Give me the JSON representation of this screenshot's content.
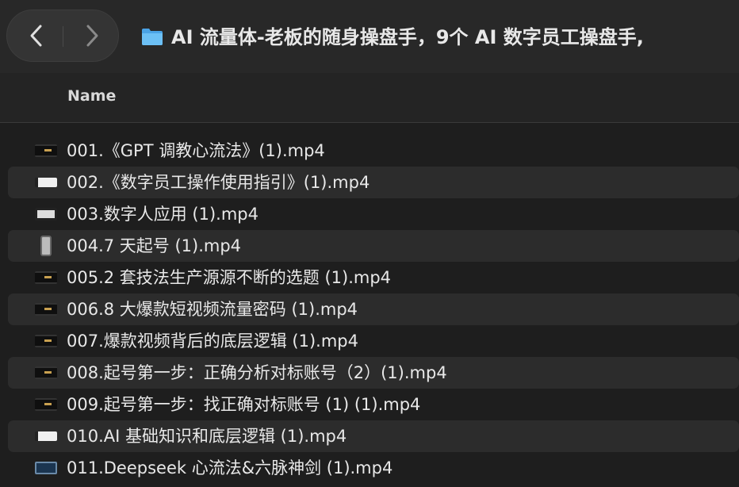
{
  "window": {
    "title": "AI 流量体-老板的随身操盘手，9个 AI 数字员工操盘手,"
  },
  "nav": {
    "back_icon": "chevron-left-icon",
    "forward_icon": "chevron-right-icon"
  },
  "header": {
    "name_label": "Name"
  },
  "files": [
    {
      "name": "001.《GPT 调教心流法》(1).mp4",
      "thumb": "dark-strip"
    },
    {
      "name": "002.《数字员工操作使用指引》(1).mp4",
      "thumb": "white-screen"
    },
    {
      "name": "003.数字人应用 (1).mp4",
      "thumb": "framed-screen"
    },
    {
      "name": "004.7 天起号 (1).mp4",
      "thumb": "phone"
    },
    {
      "name": "005.2 套技法生产源源不断的选题 (1).mp4",
      "thumb": "dark-strip"
    },
    {
      "name": "006.8 大爆款短视频流量密码 (1).mp4",
      "thumb": "dark-strip"
    },
    {
      "name": "007.爆款视频背后的底层逻辑 (1).mp4",
      "thumb": "dark-strip"
    },
    {
      "name": "008.起号第一步：正确分析对标账号（2）(1).mp4",
      "thumb": "dark-strip"
    },
    {
      "name": "009.起号第一步：找正确对标账号 (1) (1).mp4",
      "thumb": "dark-strip"
    },
    {
      "name": "010.AI 基础知识和底层逻辑 (1).mp4",
      "thumb": "white-screen"
    },
    {
      "name": "011.Deepseek 心流法&六脉神剑 (1).mp4",
      "thumb": "blue-screen"
    }
  ],
  "colors": {
    "background": "#1e1e1e",
    "toolbar": "#282828",
    "row_alt": "#2c2c2c",
    "folder": "#5eb4f0"
  }
}
